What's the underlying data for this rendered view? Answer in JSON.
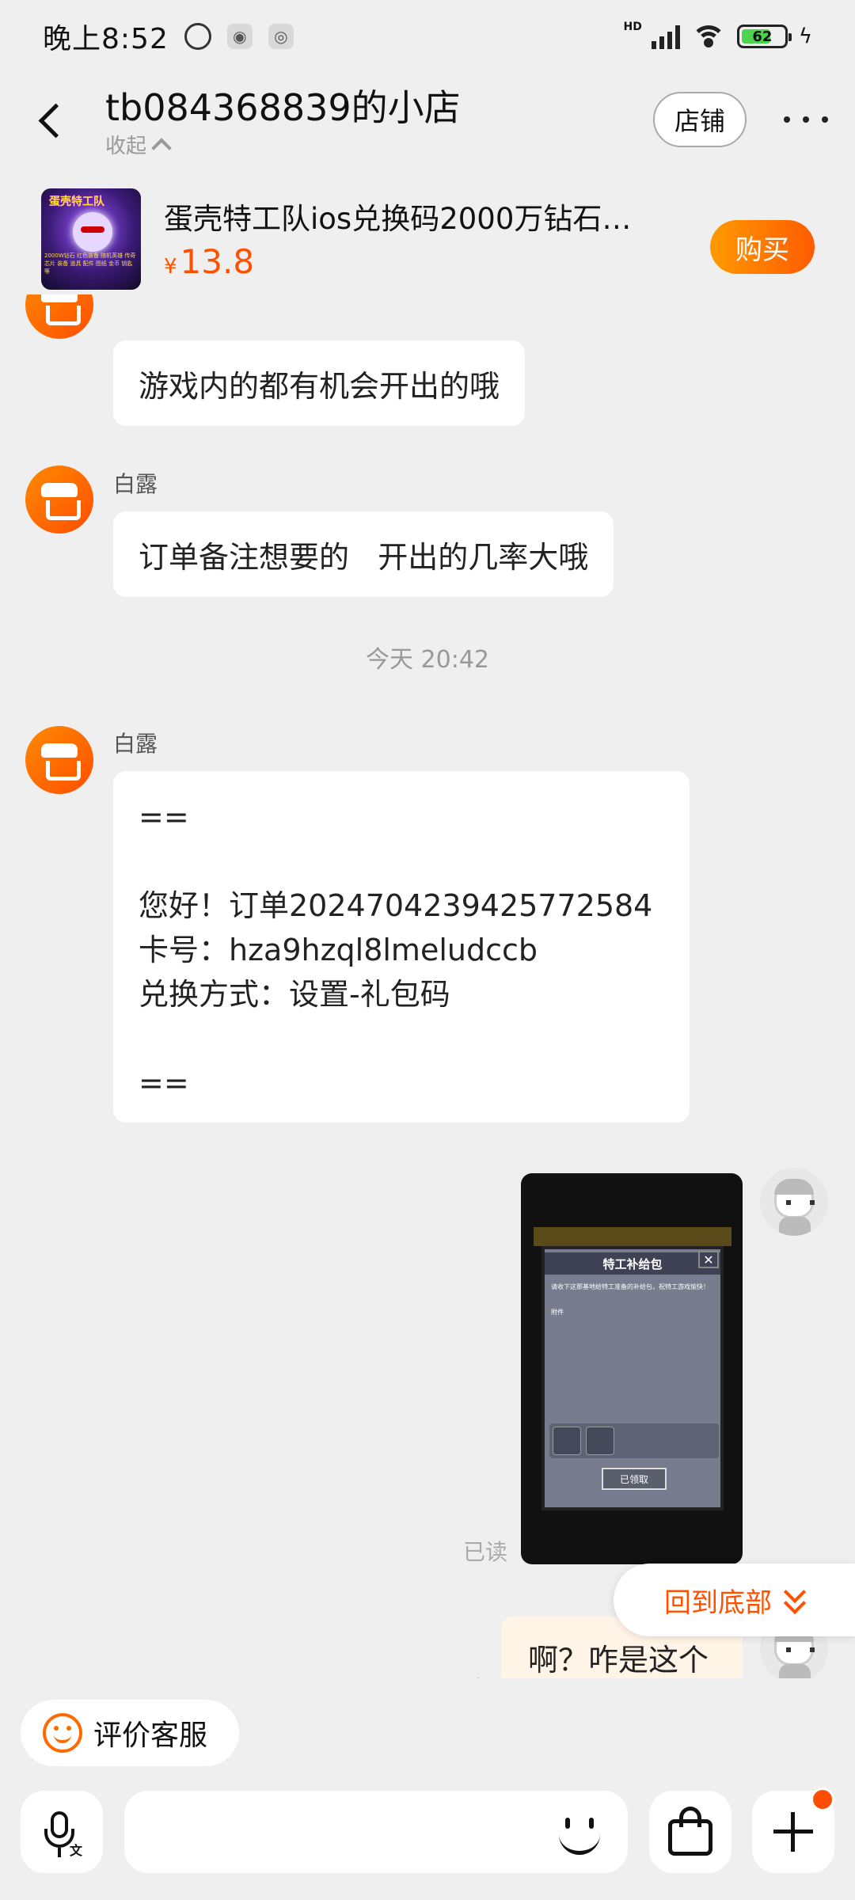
{
  "status_bar": {
    "time": "晚上8:52",
    "network": "HD",
    "battery": "62"
  },
  "header": {
    "shop_title": "tb084368839的小店",
    "collapse_label": "收起",
    "store_button": "店铺"
  },
  "product": {
    "title": "蛋壳特工队ios兑换码2000万钻石…",
    "currency": "¥",
    "price": "13.8",
    "buy_label": "购买",
    "thumb_title": "蛋壳特工队",
    "thumb_text": "2000W钻石 红色装备 随机英雄 传奇 芯片 装备 道具 配件 图纸 金币 钥匙等"
  },
  "chat": {
    "messages": [
      {
        "sender": "白露",
        "text": "游戏内的都有机会开出的哦"
      },
      {
        "sender": "白露",
        "text": "订单备注想要的   开出的几率大哦"
      },
      {
        "sender": "白露",
        "text": "==\n\n您好！订单2024704239425772584\n卡号：hza9hzql8lmeludccb\n兑换方式：设置-礼包码\n\n=="
      }
    ],
    "timestamp": "今天  20:42",
    "image_message": {
      "title": "特工补给包",
      "desc": "请收下这那基地给特工准备的补给包，祝特工游戏愉快！",
      "attach_label": "附件",
      "claim_label": "已领取",
      "close_glyph": "✕"
    },
    "read_label": "已读",
    "self_text": "啊？咋是这个",
    "jump_bottom_label": "回到底部"
  },
  "footer": {
    "rate_label": "评价客服",
    "input_placeholder": "",
    "mic_sub_label": "文"
  },
  "colors": {
    "accent": "#ff5000",
    "background": "#efefef"
  }
}
